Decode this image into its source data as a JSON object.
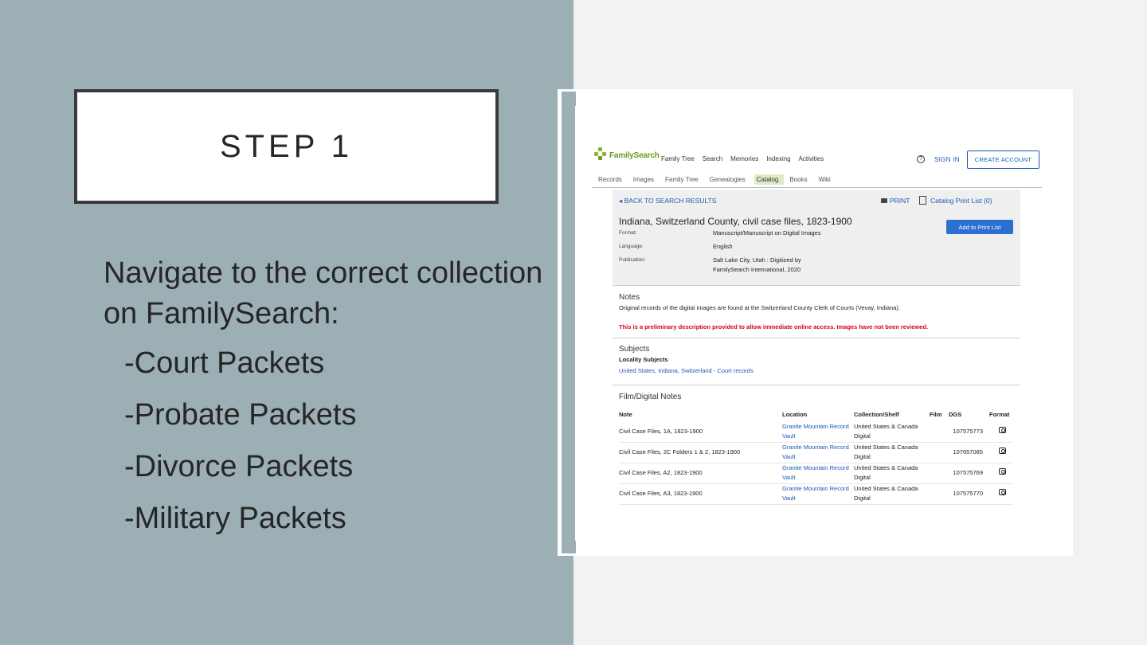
{
  "slide": {
    "step_title": "STEP 1",
    "intro": "Navigate to the correct collection on FamilySearch:",
    "bullets": [
      "-Court Packets",
      "-Probate Packets",
      "-Divorce Packets",
      "-Military Packets"
    ]
  },
  "fs": {
    "logo": "FamilySearch",
    "nav": [
      "Family Tree",
      "Search",
      "Memories",
      "Indexing",
      "Activities"
    ],
    "help": "?",
    "sign_in": "SIGN IN",
    "create_account": "CREATE ACCOUNT",
    "subnav": [
      "Records",
      "Images",
      "Family Tree",
      "Genealogies",
      "Catalog",
      "Books",
      "Wiki"
    ],
    "subnav_active": "Catalog",
    "back": "BACK TO SEARCH RESULTS",
    "print": "PRINT",
    "print_list": "Catalog Print List (0)",
    "title": "Indiana, Switzerland County, civil case files, 1823-1900",
    "add_button": "Add to Print List",
    "format_label": "Format:",
    "format_value": "Manuscript/Manuscript on Digital Images",
    "language_label": "Language:",
    "language_value": "English",
    "publication_label": "Publication:",
    "publication_value": "Salt Lake City, Utah : Digitized by FamilySearch International, 2020",
    "notes_head": "Notes",
    "notes_text": "Original records of the digital images are found at the Switzerland County Clerk of Courts (Vevay, Indiana).",
    "warning": "This is a preliminary description provided to allow immediate online access. Images have not been reviewed.",
    "subjects_head": "Subjects",
    "locality_head": "Locality Subjects",
    "locality_link": "United States, Indiana, Switzerland - Court records",
    "film_head": "Film/Digital Notes",
    "columns": [
      "Note",
      "Location",
      "Collection/Shelf",
      "Film",
      "DGS",
      "Format"
    ],
    "rows": [
      {
        "note": "Civil Case Files, 1A, 1823-1900",
        "location": "Granite Mountain Record Vault",
        "shelf": "United States & Canada Digital",
        "film": "",
        "dgs": "107575773"
      },
      {
        "note": "Civil Case Files, 2C Folders 1 & 2, 1823-1900",
        "location": "Granite Mountain Record Vault",
        "shelf": "United States & Canada Digital",
        "film": "",
        "dgs": "107657085"
      },
      {
        "note": "Civil Case Files, A2, 1823-1900",
        "location": "Granite Mountain Record Vault",
        "shelf": "United States & Canada Digital",
        "film": "",
        "dgs": "107575769"
      },
      {
        "note": "Civil Case Files, A3, 1823-1900",
        "location": "Granite Mountain Record Vault",
        "shelf": "United States & Canada Digital",
        "film": "",
        "dgs": "107575770"
      }
    ]
  }
}
